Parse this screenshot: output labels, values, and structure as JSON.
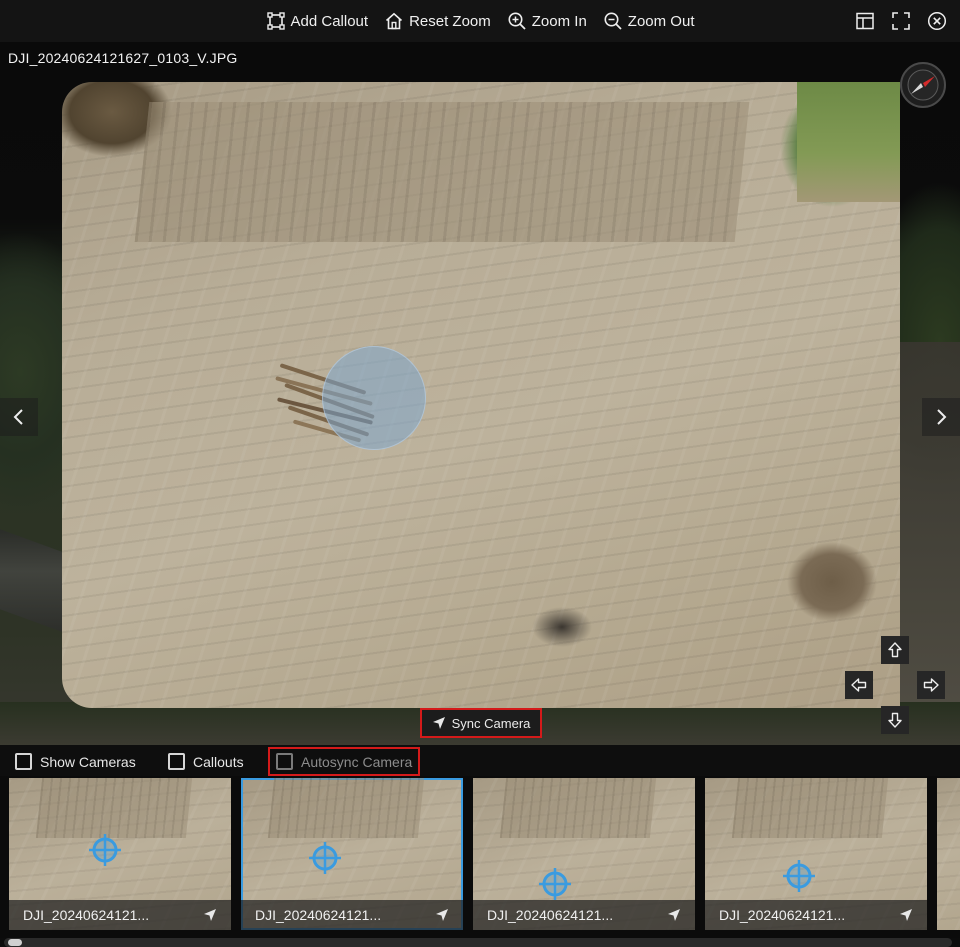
{
  "toolbar": {
    "add_callout": "Add Callout",
    "reset_zoom": "Reset Zoom",
    "zoom_in": "Zoom In",
    "zoom_out": "Zoom Out"
  },
  "viewer": {
    "filename": "DJI_20240624121627_0103_V.JPG",
    "sync_camera": "Sync Camera"
  },
  "options": {
    "show_cameras": "Show Cameras",
    "callouts": "Callouts",
    "autosync_camera": "Autosync Camera"
  },
  "thumbnails": [
    {
      "label": "DJI_20240624121..."
    },
    {
      "label": "DJI_20240624121..."
    },
    {
      "label": "DJI_20240624121..."
    },
    {
      "label": "DJI_20240624121..."
    }
  ],
  "colors": {
    "highlight": "#d41a1a",
    "selection": "#3a9be0",
    "target": "#3a9be0"
  }
}
